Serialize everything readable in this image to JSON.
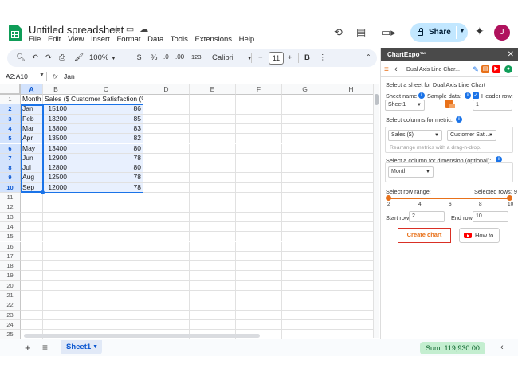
{
  "app": {
    "doc_title": "Untitled spreadsheet",
    "menu": [
      "File",
      "Edit",
      "View",
      "Insert",
      "Format",
      "Data",
      "Tools",
      "Extensions",
      "Help"
    ],
    "share_label": "Share",
    "avatar_initial": "J"
  },
  "toolbar": {
    "zoom": "100%",
    "currency": "$",
    "percent": "%",
    "dec_decrease": ".0",
    "dec_increase": ".00",
    "number_format": "123",
    "font": "Calibri",
    "font_size": "11",
    "minus": "−",
    "plus": "+",
    "bold": "B"
  },
  "formula_bar": {
    "name_box": "A2:A10",
    "fx": "fx",
    "value": "Jan"
  },
  "grid": {
    "columns": [
      "A",
      "B",
      "C",
      "D",
      "E",
      "F",
      "G",
      "H"
    ],
    "row_numbers": [
      "1",
      "2",
      "3",
      "4",
      "5",
      "6",
      "7",
      "8",
      "9",
      "10",
      "11",
      "12",
      "13",
      "14",
      "15",
      "16",
      "17",
      "18",
      "19",
      "20",
      "21",
      "22",
      "23",
      "24",
      "25"
    ],
    "headers": [
      "Month",
      "Sales ($)",
      "Customer Satisfaction (%)"
    ],
    "rows": [
      [
        "Jan",
        "15100",
        "86"
      ],
      [
        "Feb",
        "13200",
        "85"
      ],
      [
        "Mar",
        "13800",
        "83"
      ],
      [
        "Apr",
        "13500",
        "82"
      ],
      [
        "May",
        "13400",
        "80"
      ],
      [
        "Jun",
        "12900",
        "78"
      ],
      [
        "Jul",
        "12800",
        "80"
      ],
      [
        "Aug",
        "12500",
        "78"
      ],
      [
        "Sep",
        "12000",
        "78"
      ]
    ]
  },
  "bottom": {
    "add_sheet": "+",
    "sheet_name": "Sheet1",
    "sum": "Sum: 119,930.00"
  },
  "panel": {
    "title": "ChartExpo™",
    "chart_name": "Dual Axis Line Char...",
    "select_sheet_label": "Select a sheet for Dual Axis Line Chart",
    "sheet_name_label": "Sheet name:",
    "sample_data_label": "Sample data:",
    "header_row_label": "Header row:",
    "sheet_value": "Sheet1",
    "header_row_value": "1",
    "select_columns_label": "Select columns for metric:",
    "metric_1": "Sales ($)",
    "metric_2": "Customer Sati...",
    "rearrange_hint": "Rearrange metrics with a drag-n-drop.",
    "dimension_label": "Select a column for dimension (optional):",
    "dimension_value": "Month",
    "row_range_label": "Select row range:",
    "selected_rows_label": "Selected rows: 9",
    "ticks": [
      "2",
      "4",
      "6",
      "8",
      "10"
    ],
    "start_row_label": "Start row",
    "start_row_value": "2",
    "end_row_label": "End row",
    "end_row_value": "10",
    "create_chart": "Create chart",
    "how_to": "How to"
  }
}
